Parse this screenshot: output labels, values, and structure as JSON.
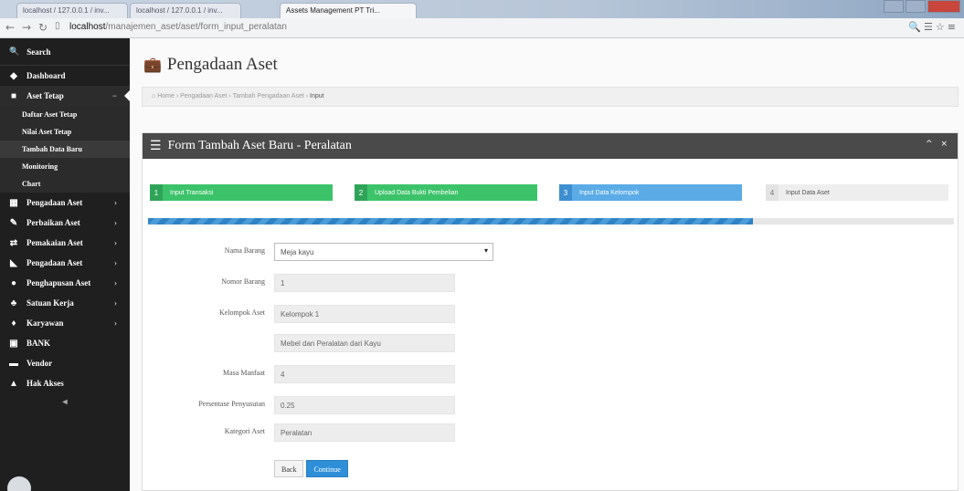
{
  "browser": {
    "tabs": [
      {
        "label": "localhost / 127.0.0.1 / inv...",
        "active": false
      },
      {
        "label": "localhost / 127.0.0.1 / inv...",
        "active": false
      },
      {
        "label": "Assets Management PT Tri...",
        "active": true
      }
    ],
    "url_host": "localhost",
    "url_path": "/manajemen_aset/aset/form_input_peralatan"
  },
  "sidebar": {
    "search_label": "Search",
    "items": [
      {
        "label": "Dashboard",
        "icon": "dashboard-icon",
        "glyph": "◆"
      },
      {
        "label": "Aset Tetap",
        "icon": "briefcase-icon",
        "glyph": "■",
        "active": true
      }
    ],
    "subitems": [
      {
        "label": "Daftar Aset Tetap"
      },
      {
        "label": "Nilai Aset Tetap"
      },
      {
        "label": "Tambah Data Baru",
        "current": true
      },
      {
        "label": "Monitoring"
      },
      {
        "label": "Chart"
      }
    ],
    "items2": [
      {
        "label": "Pengadaan Aset",
        "icon": "table-icon",
        "glyph": "▦"
      },
      {
        "label": "Perbaikan Aset",
        "icon": "wrench-icon",
        "glyph": "✎"
      },
      {
        "label": "Pemakaian Aset",
        "icon": "exchange-icon",
        "glyph": "⇄"
      },
      {
        "label": "Pengadaan Aset",
        "icon": "tag-icon",
        "glyph": "◣"
      },
      {
        "label": "Penghapusan Aset",
        "icon": "circle-icon",
        "glyph": "●"
      },
      {
        "label": "Satuan Kerja",
        "icon": "group-icon",
        "glyph": "♣"
      },
      {
        "label": "Karyawan",
        "icon": "user-icon",
        "glyph": "♦"
      },
      {
        "label": "BANK",
        "icon": "bank-icon",
        "glyph": "▣"
      },
      {
        "label": "Vendor",
        "icon": "truck-icon",
        "glyph": "▬"
      },
      {
        "label": "Hak Akses",
        "icon": "person-icon",
        "glyph": "▲"
      }
    ]
  },
  "main": {
    "page_title": "Pengadaan Aset",
    "breadcrumb": {
      "home": "Home",
      "middle": " › Pengadaan Aset › Tambah Pengadaan Aset › ",
      "current": "Input"
    },
    "panel_title": "Form Tambah Aset Baru - Peralatan",
    "steps": [
      {
        "num": "1",
        "label": "Input Transaksi",
        "state": "done"
      },
      {
        "num": "2",
        "label": "Upload Data Bukti Pembelian",
        "state": "done"
      },
      {
        "num": "3",
        "label": "Input Data Kelompok",
        "state": "current"
      },
      {
        "num": "4",
        "label": "Input Data Aset",
        "state": "todo"
      }
    ],
    "progress_fraction": 0.75,
    "form": [
      {
        "label": "Nama Barang",
        "value": "Meja kayu",
        "type": "select"
      },
      {
        "label": "Nomor Barang",
        "value": "1",
        "type": "input"
      },
      {
        "label": "Kelompok Aset",
        "value": "Kelompok 1",
        "type": "input"
      },
      {
        "label": "",
        "value": "Mebel dan Peralatan dari Kayu",
        "type": "input"
      },
      {
        "label": "Masa Manfaat",
        "value": "4",
        "type": "input"
      },
      {
        "label": "Persentase Penyusutan",
        "value": "0.25",
        "type": "input"
      },
      {
        "label": "Kategori Aset",
        "value": "Peralatan",
        "type": "input"
      }
    ],
    "back_label": "Back",
    "continue_label": "Continue"
  }
}
